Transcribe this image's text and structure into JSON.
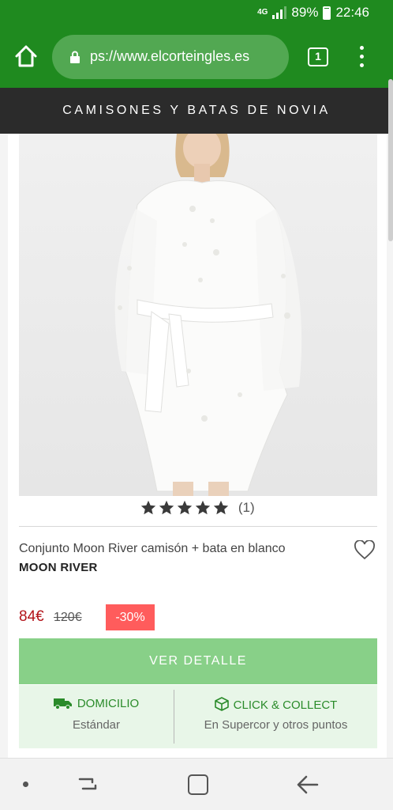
{
  "status_bar": {
    "network": "4G",
    "battery": "89%",
    "time": "22:46",
    "icons": [
      "signal-icon",
      "battery-icon"
    ]
  },
  "browser": {
    "url": "ps://www.elcorteingles.es",
    "tab_count": "1",
    "icons": [
      "home-icon",
      "lock-icon",
      "tabs-icon",
      "overflow-menu-icon"
    ]
  },
  "site_header": {
    "title": "CAMISONES Y BATAS DE NOVIA"
  },
  "product": {
    "image_alt_icon": "product-photo",
    "rating_stars": 5,
    "rating_count": "(1)",
    "name": "Conjunto Moon River camisón + bata en blanco",
    "brand": "MOON RIVER",
    "price": "84€",
    "old_price": "120€",
    "discount": "-30%",
    "detail_button": "VER DETALLE",
    "favorite_icon": "heart-icon"
  },
  "delivery": {
    "home": {
      "title": "DOMICILIO",
      "subtitle": "Estándar",
      "icon": "truck-icon"
    },
    "collect": {
      "title": "CLICK & COLLECT",
      "subtitle": "En Supercor y otros puntos",
      "icon": "box-icon"
    }
  },
  "colors": {
    "brand_green": "#1f8a1f",
    "button_green": "#88d088",
    "price_red": "#b3141a",
    "discount_red": "#ff5c5c",
    "header_dark": "#2b2b2b"
  },
  "nav_bar": {
    "icons": [
      "dot-icon",
      "recent-apps-icon",
      "home-key-icon",
      "back-icon"
    ]
  }
}
